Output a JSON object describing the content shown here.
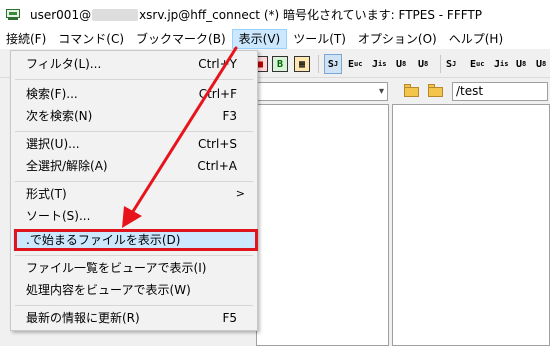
{
  "window": {
    "title_prefix": "user001@",
    "title_suffix": "xsrv.jp@hff_connect (*) 暗号化されています: FTPES - FFFTP"
  },
  "menubar": {
    "items": [
      "接続(F)",
      "コマンド(C)",
      "ブックマーク(B)",
      "表示(V)",
      "ツール(T)",
      "オプション(O)",
      "ヘルプ(H)"
    ],
    "active": "表示(V)"
  },
  "toolbar": {
    "buttons": [
      "B",
      "S",
      "E",
      "J",
      "U",
      "U",
      "S",
      "E",
      "J",
      "U",
      "U"
    ]
  },
  "pathbar": {
    "remote_path": "/test"
  },
  "view_menu": {
    "items": [
      {
        "label": "フィルタ(L)...",
        "shortcut": "Ctrl+Y"
      },
      {
        "label": "検索(F)...",
        "shortcut": "Ctrl+F"
      },
      {
        "label": "次を検索(N)",
        "shortcut": "F3"
      },
      {
        "label": "選択(U)...",
        "shortcut": "Ctrl+S"
      },
      {
        "label": "全選択/解除(A)",
        "shortcut": "Ctrl+A"
      },
      {
        "label": "形式(T)",
        "submenu": ">"
      },
      {
        "label": "ソート(S)...",
        "shortcut": ""
      },
      {
        "label": ".で始まるファイルを表示(D)",
        "shortcut": ""
      },
      {
        "label": "ファイル一覧をビューアで表示(I)",
        "shortcut": ""
      },
      {
        "label": "処理内容をビューアで表示(W)",
        "shortcut": ""
      },
      {
        "label": "最新の情報に更新(R)",
        "shortcut": "F5"
      }
    ],
    "highlighted": ".で始まるファイルを表示(D)"
  },
  "colors": {
    "highlight_border": "#e0141c",
    "arrow": "#e8141c",
    "menu_active_bg": "#cce8ff"
  }
}
